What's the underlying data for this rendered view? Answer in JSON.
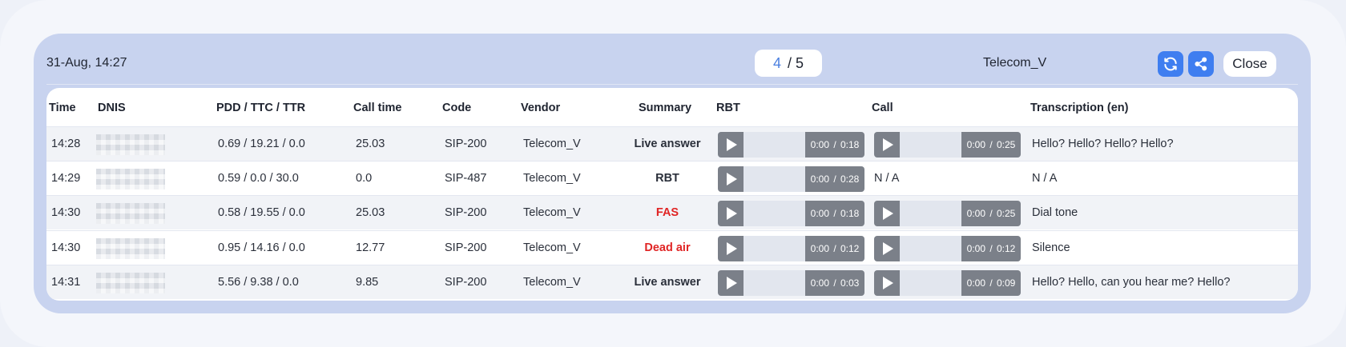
{
  "header": {
    "date": "31-Aug, 14:27",
    "page_current": "4",
    "page_total_label": "/ 5",
    "vendor": "Telecom_V",
    "close_label": "Close"
  },
  "colors": {
    "accent": "#3f7ef0",
    "error_text": "#e02424",
    "player_gray": "#7b8089"
  },
  "icons": {
    "refresh": "refresh-icon",
    "share": "share-icon",
    "play": "play-icon"
  },
  "columns": [
    "Time",
    "DNIS",
    "PDD / TTC / TTR",
    "Call time",
    "Code",
    "Vendor",
    "Summary",
    "RBT",
    "Call",
    "Transcription (en)"
  ],
  "rows": [
    {
      "time": "14:28",
      "pdd": "0.69 / 19.21 / 0.0",
      "call_time": "25.03",
      "code": "SIP-200",
      "vendor": "Telecom_V",
      "summary": "Live answer",
      "summary_alert": false,
      "rbt_time": "0:00  /  0:18",
      "call_time_label": "0:00  /  0:25",
      "call_na": "",
      "transcription": "Hello? Hello? Hello? Hello?"
    },
    {
      "time": "14:29",
      "pdd": "0.59 / 0.0 / 30.0",
      "call_time": "0.0",
      "code": "SIP-487",
      "vendor": "Telecom_V",
      "summary": "RBT",
      "summary_alert": false,
      "rbt_time": "0:00  /  0:28",
      "call_time_label": "",
      "call_na": "N / A",
      "transcription": "N / A"
    },
    {
      "time": "14:30",
      "pdd": "0.58 / 19.55 / 0.0",
      "call_time": "25.03",
      "code": "SIP-200",
      "vendor": "Telecom_V",
      "summary": "FAS",
      "summary_alert": true,
      "rbt_time": "0:00  /  0:18",
      "call_time_label": "0:00  /  0:25",
      "call_na": "",
      "transcription": "Dial tone"
    },
    {
      "time": "14:30",
      "pdd": "0.95 / 14.16 / 0.0",
      "call_time": "12.77",
      "code": "SIP-200",
      "vendor": "Telecom_V",
      "summary": "Dead air",
      "summary_alert": true,
      "rbt_time": "0:00  /  0:12",
      "call_time_label": "0:00  /  0:12",
      "call_na": "",
      "transcription": "Silence"
    },
    {
      "time": "14:31",
      "pdd": "5.56 / 9.38 / 0.0",
      "call_time": "9.85",
      "code": "SIP-200",
      "vendor": "Telecom_V",
      "summary": "Live answer",
      "summary_alert": false,
      "rbt_time": "0:00  /  0:03",
      "call_time_label": "0:00  /  0:09",
      "call_na": "",
      "transcription": "Hello? Hello, can you hear me? Hello?"
    }
  ]
}
